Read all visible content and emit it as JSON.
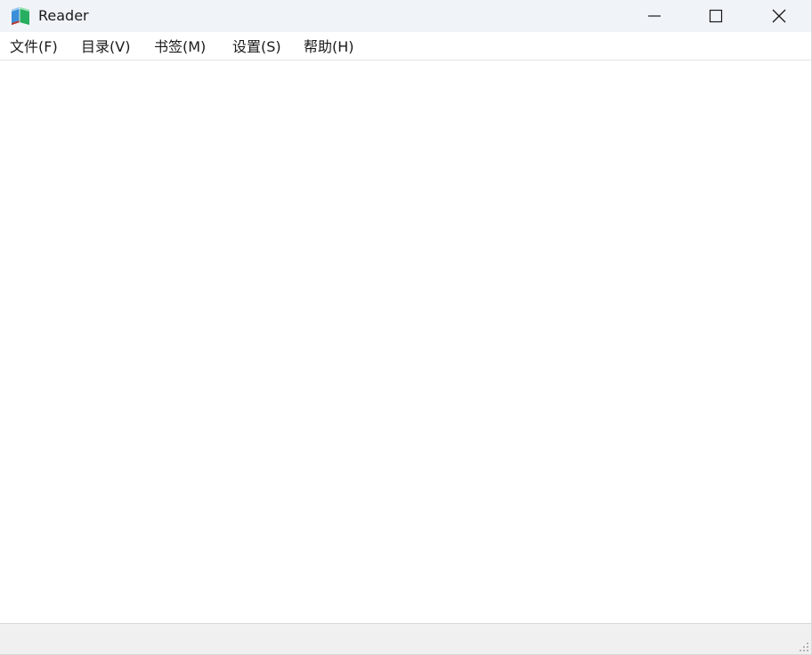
{
  "window": {
    "title": "Reader",
    "app_icon": "book-icon",
    "caption_buttons": [
      "minimize-icon",
      "maximize-icon",
      "close-icon"
    ]
  },
  "menubar": {
    "items": [
      {
        "label": "文件(F)"
      },
      {
        "label": "目录(V)"
      },
      {
        "label": "书签(M)"
      },
      {
        "label": "设置(S)"
      },
      {
        "label": "帮助(H)"
      }
    ]
  },
  "colors": {
    "titlebar_bg": "#f0f4f9",
    "statusbar_bg": "#f0f0f0",
    "content_bg": "#ffffff",
    "icon_blue": "#2e86de",
    "icon_green": "#27ae60",
    "icon_red": "#d63031"
  }
}
